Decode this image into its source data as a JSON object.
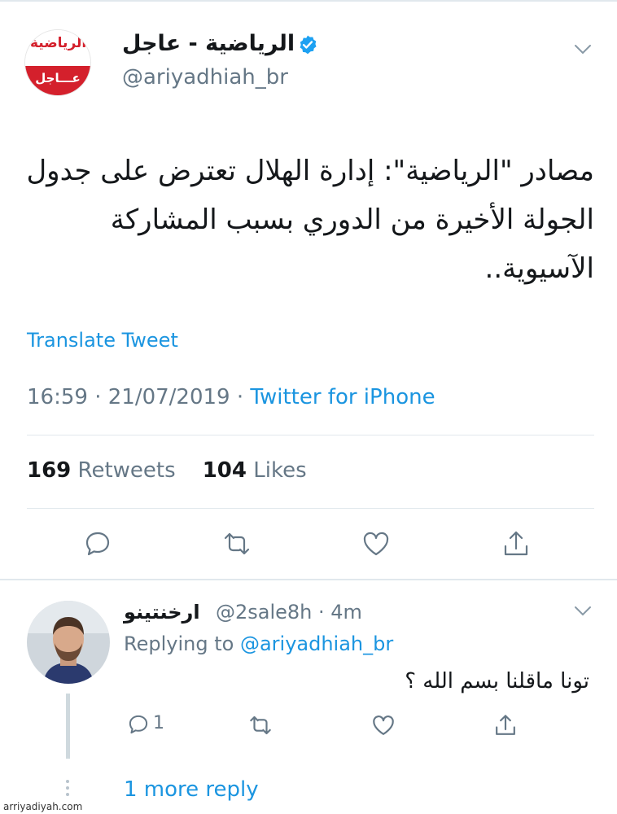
{
  "tweet": {
    "logo_text": "الرياضية",
    "logo_sub": "عـــاجل",
    "name": "الرياضية - عاجل",
    "handle": "@ariyadhiah_br",
    "text": "مصادر \"الرياضية\": إدارة الهلال تعترض على جدول الجولة الأخيرة من الدوري بسبب المشاركة الآسيوية..",
    "translate_label": "Translate Tweet",
    "time": "16:59",
    "date": "21/07/2019",
    "source": "Twitter for iPhone",
    "retweets": "169",
    "retweets_label": "Retweets",
    "likes": "104",
    "likes_label": "Likes"
  },
  "reply": {
    "name": "ارخنتينو",
    "handle_time": "@2sale8h · 4m",
    "replying_prefix": "Replying to",
    "replying_to": "@ariyadhiah_br",
    "text": "تونا ماقلنا بسم الله ؟",
    "reply_count": "1",
    "more_replies": "1 more reply"
  },
  "watermark": "arriyadiyah.com",
  "colors": {
    "link": "#1b95e0",
    "muted": "#657786",
    "brand_red": "#d4202c"
  }
}
